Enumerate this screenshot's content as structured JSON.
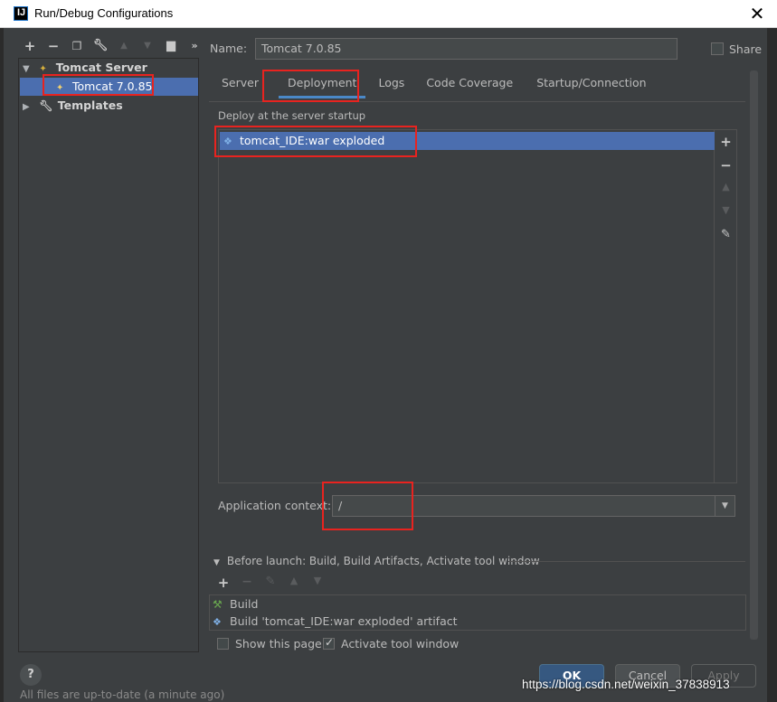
{
  "window": {
    "title": "Run/Debug Configurations",
    "app_icon": "IJ",
    "close": "✕"
  },
  "left_toolbar": {
    "icons": [
      "add-icon",
      "remove-icon",
      "copy-icon",
      "wrench-icon",
      "move-up-icon",
      "move-down-icon",
      "folder-add-icon",
      "more-icon"
    ]
  },
  "tree": {
    "group_label": "Tomcat Server",
    "item_label": "Tomcat 7.0.85",
    "templates_label": "Templates"
  },
  "name_field": {
    "label": "Name:",
    "value": "Tomcat 7.0.85"
  },
  "share": {
    "label": "Share",
    "checked": false
  },
  "tabs": [
    "Server",
    "Deployment",
    "Logs",
    "Code Coverage",
    "Startup/Connection"
  ],
  "active_tab": "Deployment",
  "deployment": {
    "section_title": "Deploy at the server startup",
    "items": [
      "tomcat_IDE:war exploded"
    ]
  },
  "app_context": {
    "label": "Application context:",
    "value": "/"
  },
  "before_launch": {
    "header": "Before launch: Build, Build Artifacts, Activate tool window",
    "tasks": [
      "Build",
      "Build 'tomcat_IDE:war exploded' artifact"
    ]
  },
  "options": {
    "show_page_label": "Show this page",
    "show_page_checked": false,
    "activate_label": "Activate tool window",
    "activate_checked": true
  },
  "buttons": {
    "help": "?",
    "ok": "OK",
    "cancel": "Cancel",
    "apply": "Apply"
  },
  "status_bar": "All files are up-to-date (a minute ago)",
  "watermark": "https://blog.csdn.net/weixin_37838913",
  "colors": {
    "background": "#3c3f41",
    "selection": "#4b6eaf",
    "annotation": "#e8231f",
    "ok_button": "#365880"
  }
}
